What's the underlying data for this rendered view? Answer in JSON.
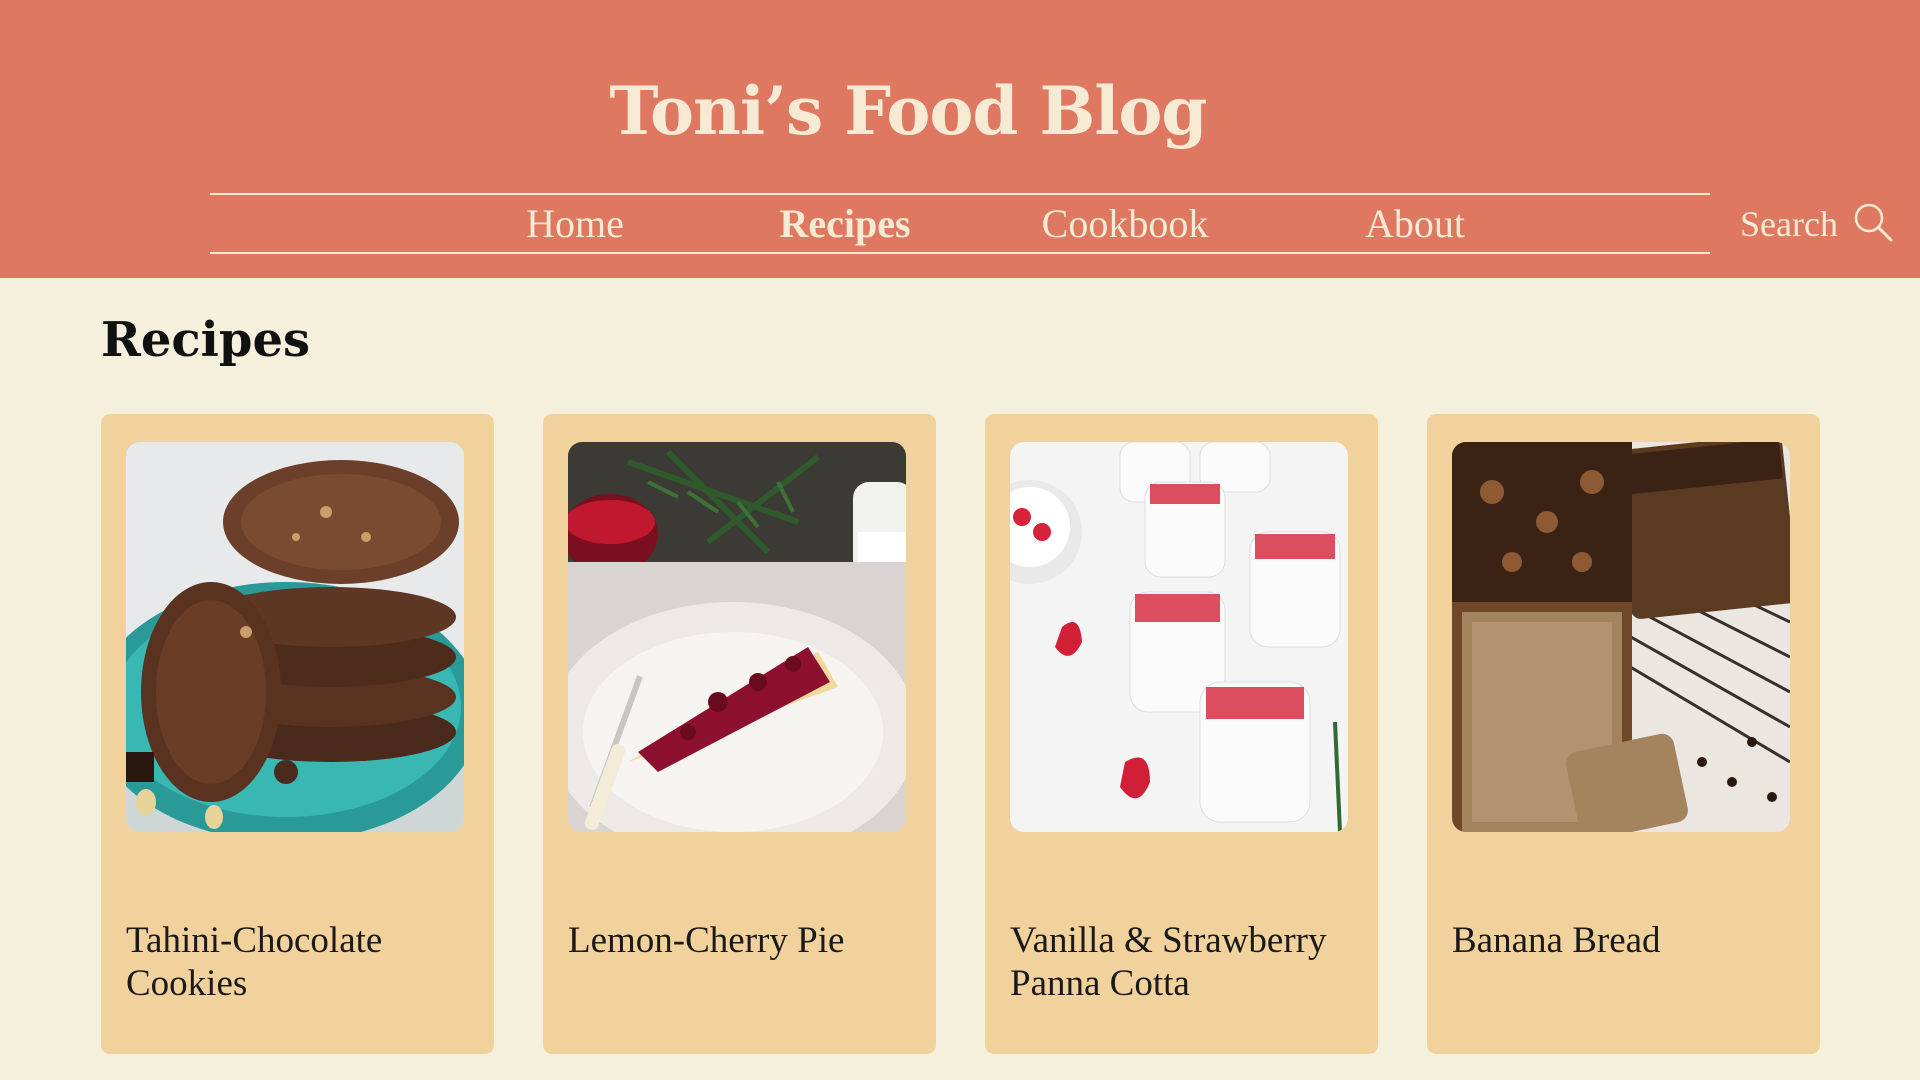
{
  "header": {
    "site_title": "Toni’s Food Blog",
    "background_color": "#df7860",
    "text_color": "#f7ead4"
  },
  "nav": {
    "items": [
      {
        "label": "Home",
        "active": false
      },
      {
        "label": "Recipes",
        "active": true
      },
      {
        "label": "Cookbook",
        "active": false
      },
      {
        "label": "About",
        "active": false
      }
    ]
  },
  "search": {
    "label": "Search",
    "icon": "search-icon"
  },
  "main": {
    "page_title": "Recipes",
    "background_color": "#f5f0dc",
    "card_color": "#f2d29c",
    "cards": [
      {
        "title": "Tahini-Chocolate Cookies",
        "image": "chocolate-cookies-photo"
      },
      {
        "title": "Lemon-Cherry Pie",
        "image": "cherry-pie-photo"
      },
      {
        "title": "Vanilla & Strawberry Panna Cotta",
        "image": "panna-cotta-photo"
      },
      {
        "title": "Banana Bread",
        "image": "banana-bread-photo"
      }
    ]
  }
}
